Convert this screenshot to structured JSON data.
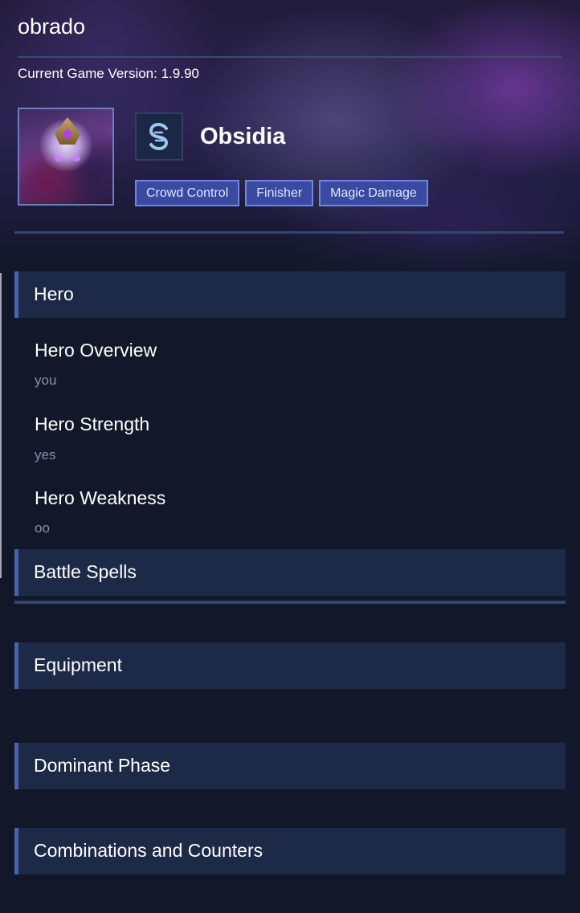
{
  "app": {
    "title": "obrado",
    "version_label": "Current Game Version:",
    "version_value": "1.9.90"
  },
  "hero": {
    "name": "Obsidia",
    "role_icon": "marksman-s-icon",
    "tags": [
      "Crowd Control",
      "Finisher",
      "Magic Damage"
    ]
  },
  "sections": {
    "hero": {
      "title": "Hero",
      "fields": [
        {
          "label": "Hero Overview",
          "value": "you"
        },
        {
          "label": "Hero Strength",
          "value": "yes"
        },
        {
          "label": "Hero Weakness",
          "value": "oo"
        }
      ]
    },
    "battle_spells": {
      "title": "Battle Spells"
    },
    "equipment": {
      "title": "Equipment"
    },
    "dominant_phase": {
      "title": "Dominant Phase"
    },
    "combinations": {
      "title": "Combinations and Counters"
    }
  },
  "colors": {
    "background": "#121829",
    "section_bg": "#1d2a47",
    "accent": "#4a62b0",
    "tag_bg": "#3a4aa0",
    "tag_border": "#6f86e0",
    "muted_text": "#8390b0"
  }
}
